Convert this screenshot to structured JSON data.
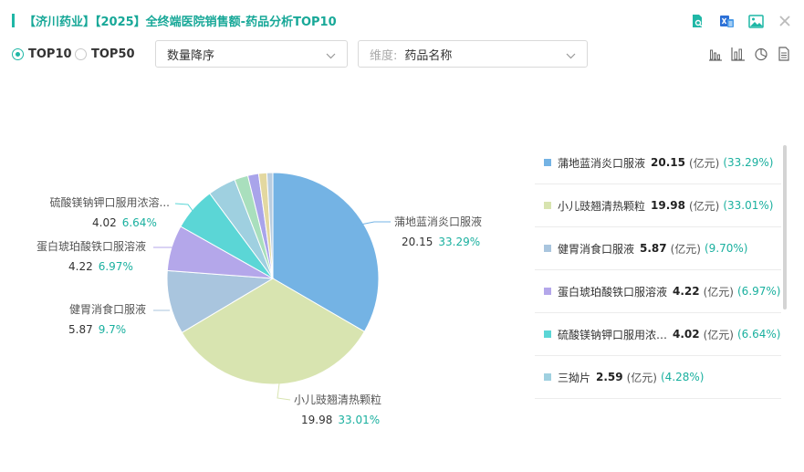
{
  "header": {
    "title": "【济川药业】【2025】全终端医院销售额-药品分析TOP10",
    "icons": [
      "search-report-icon",
      "excel-export-icon",
      "image-export-icon",
      "close-icon"
    ]
  },
  "controls": {
    "radio_top10": "TOP10",
    "radio_top50": "TOP50",
    "selected_radio": "TOP10",
    "sort_select": "数量降序",
    "dimension_prefix": "维度:",
    "dimension_select": "药品名称",
    "view_icons": [
      "bar-chart-icon",
      "column-chart-icon",
      "pie-chart-icon",
      "table-view-icon"
    ]
  },
  "colors": {
    "accent": "#1fb7a6",
    "percent_text": "#1ab09f"
  },
  "chart_data": {
    "type": "pie",
    "unit": "(亿元)",
    "slices": [
      {
        "name": "蒲地蓝消炎口服液",
        "value": 20.15,
        "percent": "33.29%",
        "label_percent": "33.29%",
        "color": "#74b3e4"
      },
      {
        "name": "小儿豉翘清热颗粒",
        "value": 19.98,
        "percent": "33.01%",
        "label_percent": "33.01%",
        "color": "#d8e4b0"
      },
      {
        "name": "健胃消食口服液",
        "value": 5.87,
        "percent": "9.70%",
        "label_percent": "9.7%",
        "color": "#a9c5de"
      },
      {
        "name": "蛋白琥珀酸铁口服溶液",
        "value": 4.22,
        "percent": "6.97%",
        "label_percent": "6.97%",
        "color": "#b4a7ea"
      },
      {
        "name": "硫酸镁钠钾口服用浓溶液",
        "label_name": "硫酸镁钠钾口服用浓溶...",
        "legend_name": "硫酸镁钠钾口服用浓…",
        "value": 4.02,
        "percent": "6.64%",
        "label_percent": "6.64%",
        "color": "#5bd6d6"
      },
      {
        "name": "三拗片",
        "value": 2.59,
        "percent": "4.28%",
        "color": "#9fd0e0"
      },
      {
        "name": "",
        "value": 1.25,
        "color": "#a9dfbd"
      },
      {
        "name": "",
        "value": 1.0,
        "color": "#a9a4ea"
      },
      {
        "name": "",
        "value": 0.75,
        "color": "#e3d8a0"
      },
      {
        "name": "",
        "value": 0.55,
        "color": "#b9cde0"
      }
    ],
    "legend_visible": 6
  }
}
